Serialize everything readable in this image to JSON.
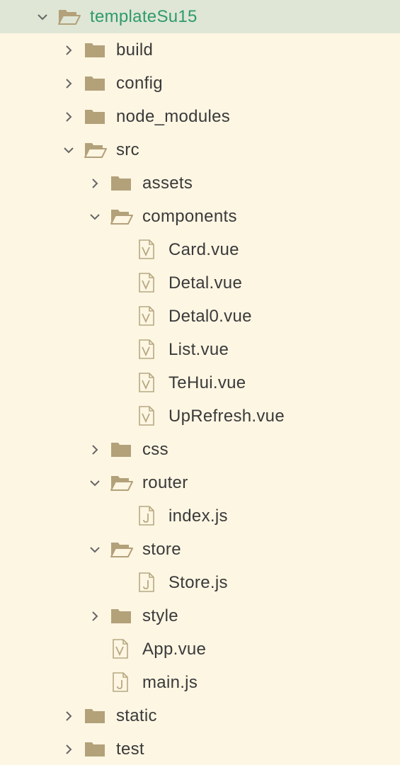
{
  "tree": {
    "rows": [
      {
        "name": "root-folder-templatesu15",
        "label": "templateSu15",
        "kind": "folder",
        "depth": 0,
        "expanded": true,
        "selected": true
      },
      {
        "name": "tree-item-build",
        "label": "build",
        "kind": "folder",
        "depth": 1,
        "expanded": false
      },
      {
        "name": "tree-item-config",
        "label": "config",
        "kind": "folder",
        "depth": 1,
        "expanded": false
      },
      {
        "name": "tree-item-node-modules",
        "label": "node_modules",
        "kind": "folder",
        "depth": 1,
        "expanded": false
      },
      {
        "name": "tree-item-src",
        "label": "src",
        "kind": "folder",
        "depth": 1,
        "expanded": true
      },
      {
        "name": "tree-item-assets",
        "label": "assets",
        "kind": "folder",
        "depth": 2,
        "expanded": false
      },
      {
        "name": "tree-item-components",
        "label": "components",
        "kind": "folder",
        "depth": 2,
        "expanded": true
      },
      {
        "name": "tree-item-card-vue",
        "label": "Card.vue",
        "kind": "vue",
        "depth": 3
      },
      {
        "name": "tree-item-detal-vue",
        "label": "Detal.vue",
        "kind": "vue",
        "depth": 3
      },
      {
        "name": "tree-item-detal0-vue",
        "label": "Detal0.vue",
        "kind": "vue",
        "depth": 3
      },
      {
        "name": "tree-item-list-vue",
        "label": "List.vue",
        "kind": "vue",
        "depth": 3
      },
      {
        "name": "tree-item-tehui-vue",
        "label": "TeHui.vue",
        "kind": "vue",
        "depth": 3
      },
      {
        "name": "tree-item-uprefresh-vue",
        "label": "UpRefresh.vue",
        "kind": "vue",
        "depth": 3
      },
      {
        "name": "tree-item-css",
        "label": "css",
        "kind": "folder",
        "depth": 2,
        "expanded": false
      },
      {
        "name": "tree-item-router",
        "label": "router",
        "kind": "folder",
        "depth": 2,
        "expanded": true
      },
      {
        "name": "tree-item-index-js",
        "label": "index.js",
        "kind": "js",
        "depth": 3
      },
      {
        "name": "tree-item-store",
        "label": "store",
        "kind": "folder",
        "depth": 2,
        "expanded": true
      },
      {
        "name": "tree-item-store-js",
        "label": "Store.js",
        "kind": "js",
        "depth": 3
      },
      {
        "name": "tree-item-style",
        "label": "style",
        "kind": "folder",
        "depth": 2,
        "expanded": false
      },
      {
        "name": "tree-item-app-vue",
        "label": "App.vue",
        "kind": "vue",
        "depth": 2
      },
      {
        "name": "tree-item-main-js",
        "label": "main.js",
        "kind": "js",
        "depth": 2
      },
      {
        "name": "tree-item-static",
        "label": "static",
        "kind": "folder",
        "depth": 1,
        "expanded": false
      },
      {
        "name": "tree-item-test",
        "label": "test",
        "kind": "folder",
        "depth": 1,
        "expanded": false
      }
    ]
  },
  "colors": {
    "background": "#fdf6e3",
    "selected_row": "#dfe6d5",
    "selected_text": "#2d9b6c",
    "text": "#3a3a3a",
    "folder": "#b3a17a",
    "file_icon": "#b7a882",
    "chevron": "#666666"
  },
  "icons": {
    "folder_closed": "folder-icon",
    "folder_open": "folder-open-icon",
    "vue_file": "vue-file-icon",
    "js_file": "js-file-icon",
    "collapsed": "chevron-right-icon",
    "expanded": "chevron-down-icon"
  }
}
